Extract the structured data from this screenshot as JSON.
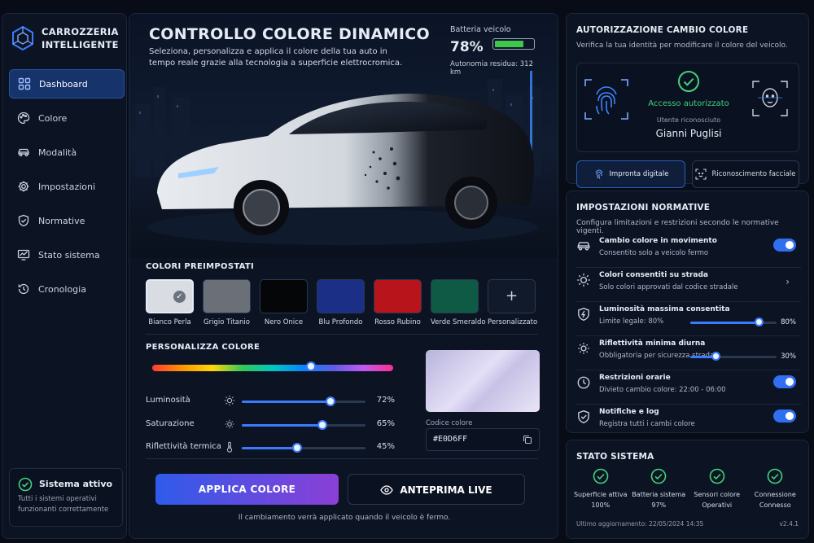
{
  "app": {
    "name_line1": "CARROZZERIA",
    "name_line2": "INTELLIGENTE"
  },
  "sidebar": {
    "items": [
      {
        "label": "Dashboard",
        "icon": "grid-icon",
        "active": true
      },
      {
        "label": "Colore",
        "icon": "palette-icon"
      },
      {
        "label": "Modalità",
        "icon": "car-icon"
      },
      {
        "label": "Impostazioni",
        "icon": "gear-icon"
      },
      {
        "label": "Normative",
        "icon": "shield-icon"
      },
      {
        "label": "Stato sistema",
        "icon": "monitor-chart-icon"
      },
      {
        "label": "Cronologia",
        "icon": "history-icon"
      }
    ],
    "status": {
      "title": "Sistema attivo",
      "desc": "Tutti i sistemi operativi funzionanti correttamente"
    }
  },
  "hero": {
    "title": "CONTROLLO COLORE DINAMICO",
    "subtitle": "Seleziona, personalizza e applica il colore della tua auto in tempo reale grazie alla tecnologia a superficie elettrocromica.",
    "battery": {
      "label": "Batteria veicolo",
      "percent": "78%",
      "level": 0.78,
      "range": "Autonomia residua: 312 km"
    }
  },
  "presets": {
    "title": "COLORI PREIMPOSTATI",
    "items": [
      {
        "name": "Bianco Perla",
        "color": "#d9dde3",
        "selected": true
      },
      {
        "name": "Grigio Titanio",
        "color": "#6b7078"
      },
      {
        "name": "Nero Onice",
        "color": "#050608"
      },
      {
        "name": "Blu Profondo",
        "color": "#1b2f86"
      },
      {
        "name": "Rosso Rubino",
        "color": "#b8141c"
      },
      {
        "name": "Verde Smeraldo",
        "color": "#0f5a45"
      },
      {
        "name": "Personalizzato",
        "color": ""
      }
    ],
    "custom_symbol": "+"
  },
  "customize": {
    "title": "PERSONALIZZA COLORE",
    "hue_position": 0.66,
    "sliders": [
      {
        "label": "Luminosità",
        "value": "72%",
        "level": 0.72,
        "icon": "sun-icon"
      },
      {
        "label": "Saturazione",
        "value": "65%",
        "level": 0.65,
        "icon": "sun-outline-icon"
      },
      {
        "label": "Riflettività termica",
        "value": "45%",
        "level": 0.45,
        "icon": "thermometer-icon"
      }
    ],
    "code_label": "Codice colore",
    "code_value": "#E0D6FF"
  },
  "actions": {
    "apply": "APPLICA COLORE",
    "preview": "ANTEPRIMA LIVE",
    "note": "Il cambiamento verrà applicato quando il veicolo è fermo."
  },
  "auth": {
    "title": "AUTORIZZAZIONE CAMBIO COLORE",
    "subtitle": "Verifica la tua identità per modificare il colore del veicolo.",
    "status": "Accesso autorizzato",
    "recognized_label": "Utente riconosciuto",
    "user": "Gianni Puglisi",
    "btn_fingerprint": "Impronta digitale",
    "btn_face": "Riconoscimento facciale"
  },
  "norms": {
    "title": "IMPOSTAZIONI NORMATIVE",
    "subtitle": "Configura limitazioni e restrizioni secondo le normative vigenti.",
    "rows": [
      {
        "title": "Cambio colore in movimento",
        "desc": "Consentito solo a veicolo fermo",
        "control": "toggle",
        "icon": "car-icon"
      },
      {
        "title": "Colori consentiti su strada",
        "desc": "Solo colori approvati dal codice stradale",
        "control": "chevron",
        "icon": "sun-icon"
      },
      {
        "title": "Luminosità massima consentita",
        "desc": "Limite legale: 80%",
        "control": "slider",
        "value": "80%",
        "level": 0.8,
        "icon": "shield-bolt-icon"
      },
      {
        "title": "Riflettività minima diurna",
        "desc": "Obbligatoria per sicurezza stradale",
        "control": "slider",
        "value": "30%",
        "level": 0.3,
        "icon": "sun-outline-icon"
      },
      {
        "title": "Restrizioni orarie",
        "desc": "Divieto cambio colore: 22:00 - 06:00",
        "control": "toggle",
        "icon": "clock-icon"
      },
      {
        "title": "Notifiche e log",
        "desc": "Registra tutti i cambi colore",
        "control": "toggle",
        "icon": "shield-check-icon"
      }
    ],
    "chevron": "›"
  },
  "system": {
    "title": "STATO SISTEMA",
    "items": [
      {
        "name": "Superficie attiva",
        "value": "100%"
      },
      {
        "name": "Batteria sistema",
        "value": "97%"
      },
      {
        "name": "Sensori colore",
        "value": "Operativi"
      },
      {
        "name": "Connessione",
        "value": "Connesso"
      }
    ],
    "updated": "Ultimo aggiornamento: 22/05/2024 14:35",
    "version": "v2.4.1"
  },
  "colors": {
    "accent": "#2f6ff0",
    "success": "#43d17a",
    "panel": "#0c1424"
  }
}
